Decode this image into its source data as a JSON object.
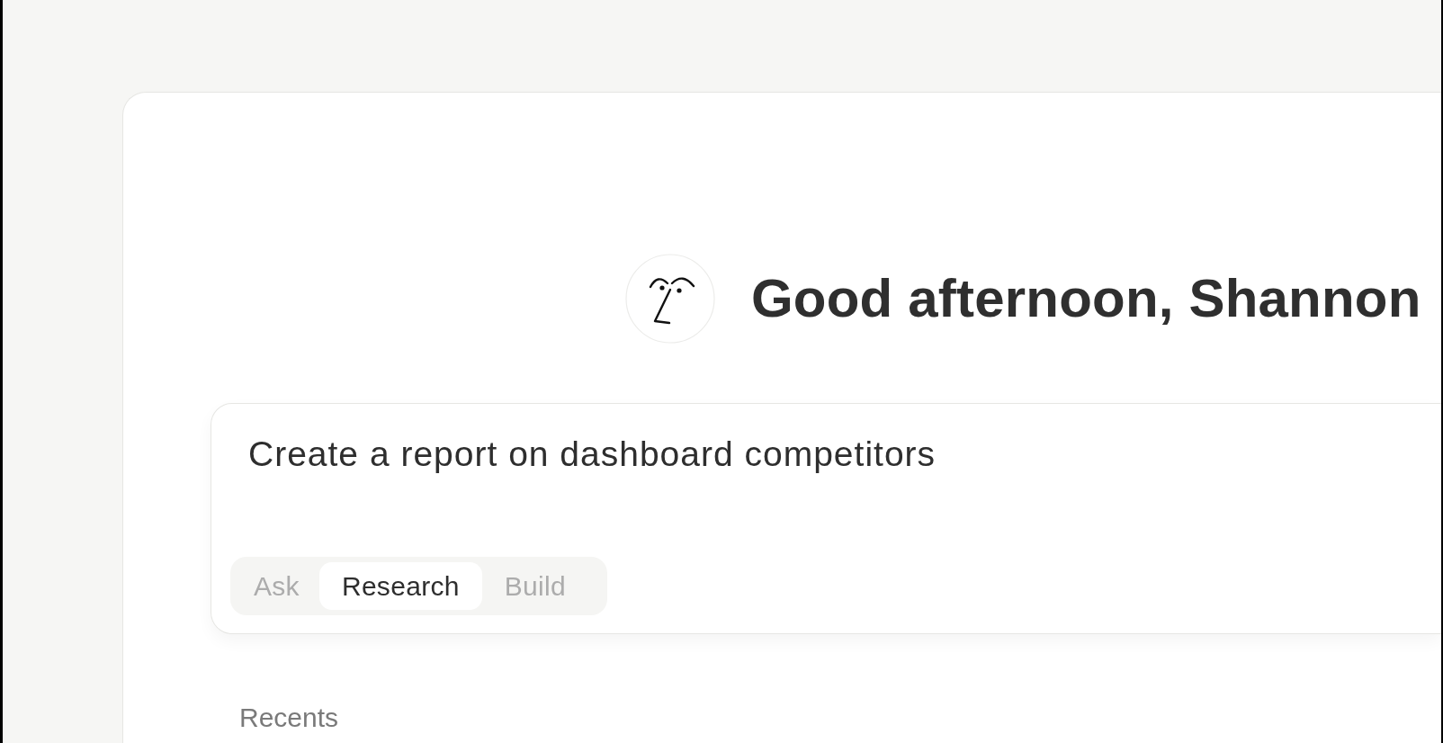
{
  "greeting": {
    "text": "Good afternoon, Shannon"
  },
  "prompt": {
    "value": "Create a report on dashboard competitors"
  },
  "modes": [
    {
      "label": "Ask",
      "selected": false
    },
    {
      "label": "Research",
      "selected": true
    },
    {
      "label": "Build",
      "selected": false
    }
  ],
  "recents": {
    "title": "Recents"
  }
}
